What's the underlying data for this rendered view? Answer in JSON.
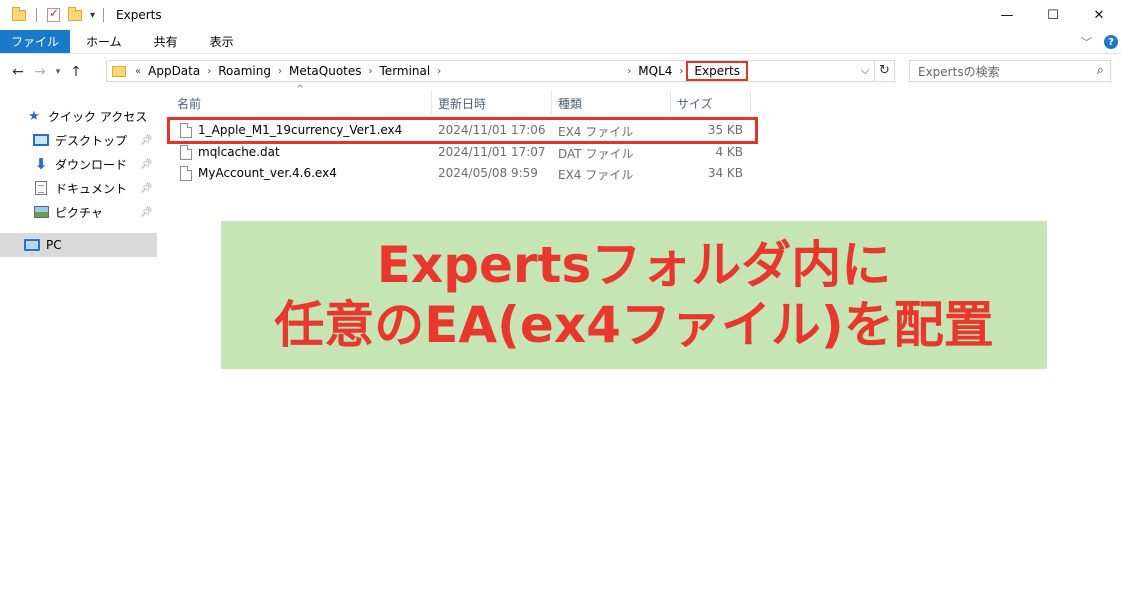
{
  "window": {
    "title": "Experts",
    "controls": {
      "minimize": "—",
      "maximize": "☐",
      "close": "✕"
    }
  },
  "ribbon": {
    "tabs": [
      "ファイル",
      "ホーム",
      "共有",
      "表示"
    ],
    "collapse_icon": "chevron-down-icon",
    "help_label": "?"
  },
  "address": {
    "prefix": "«",
    "crumbs": [
      "AppData",
      "Roaming",
      "MetaQuotes",
      "Terminal",
      "MQL4",
      "Experts"
    ],
    "separator": "›"
  },
  "search": {
    "placeholder": "Expertsの検索"
  },
  "sidebar": {
    "items": [
      {
        "label": "クイック アクセス",
        "icon": "star-icon",
        "pinned": false
      },
      {
        "label": "デスクトップ",
        "icon": "desktop-icon",
        "pinned": true
      },
      {
        "label": "ダウンロード",
        "icon": "download-icon",
        "pinned": true
      },
      {
        "label": "ドキュメント",
        "icon": "document-icon",
        "pinned": true
      },
      {
        "label": "ピクチャ",
        "icon": "pictures-icon",
        "pinned": true
      },
      {
        "label": "PC",
        "icon": "pc-icon",
        "pinned": false,
        "selected": true
      }
    ]
  },
  "columns": {
    "name": "名前",
    "modified": "更新日時",
    "type": "種類",
    "size": "サイズ"
  },
  "files": [
    {
      "name": "1_Apple_M1_19currency_Ver1.ex4",
      "modified": "2024/11/01 17:06",
      "type": "EX4 ファイル",
      "size": "35 KB",
      "highlighted": true
    },
    {
      "name": "mqlcache.dat",
      "modified": "2024/11/01 17:07",
      "type": "DAT ファイル",
      "size": "4 KB",
      "highlighted": false
    },
    {
      "name": "MyAccount_ver.4.6.ex4",
      "modified": "2024/05/08 9:59",
      "type": "EX4 ファイル",
      "size": "34 KB",
      "highlighted": false
    }
  ],
  "annotation": {
    "line1": "Expertsフォルダ内に",
    "line2": "任意のEA(ex4ファイル)を配置",
    "text_color": "#e8372c",
    "background": "#c6e5b4"
  },
  "colors": {
    "accent": "#1979ca",
    "highlight_border": "#e5332a"
  }
}
